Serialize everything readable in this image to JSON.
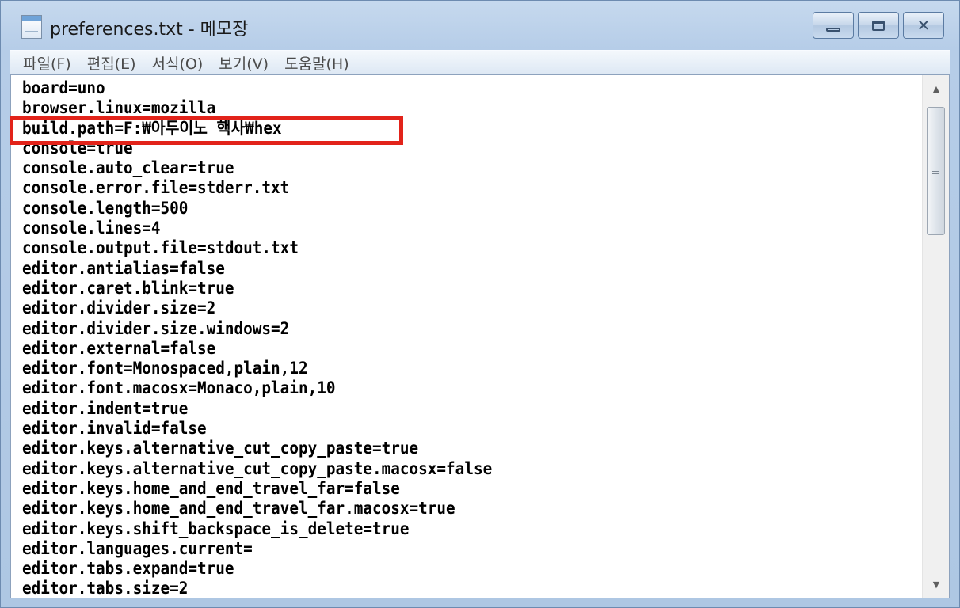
{
  "window": {
    "title": "preferences.txt - 메모장",
    "buttons": {
      "minimize": "▭",
      "maximize": "▣",
      "close": "✕"
    }
  },
  "menu": [
    "파일(F)",
    "편집(E)",
    "서식(O)",
    "보기(V)",
    "도움말(H)"
  ],
  "editor": {
    "lines": [
      "board=uno",
      "browser.linux=mozilla",
      "build.path=F:₩아두이노 핵사₩hex",
      "console=true",
      "console.auto_clear=true",
      "console.error.file=stderr.txt",
      "console.length=500",
      "console.lines=4",
      "console.output.file=stdout.txt",
      "editor.antialias=false",
      "editor.caret.blink=true",
      "editor.divider.size=2",
      "editor.divider.size.windows=2",
      "editor.external=false",
      "editor.font=Monospaced,plain,12",
      "editor.font.macosx=Monaco,plain,10",
      "editor.indent=true",
      "editor.invalid=false",
      "editor.keys.alternative_cut_copy_paste=true",
      "editor.keys.alternative_cut_copy_paste.macosx=false",
      "editor.keys.home_and_end_travel_far=false",
      "editor.keys.home_and_end_travel_far.macosx=true",
      "editor.keys.shift_backspace_is_delete=true",
      "editor.languages.current=",
      "editor.tabs.expand=true",
      "editor.tabs.size=2"
    ],
    "highlighted_line_index": 2
  },
  "colors": {
    "highlight_border": "#e2231a",
    "titlebar": "#b6cde8",
    "editor_background": "#ffffff"
  },
  "icons": {
    "app": "notepad-icon",
    "scroll_up": "triangle-up-icon",
    "scroll_down": "triangle-down-icon"
  },
  "scroll": {
    "up": "▲",
    "down": "▼"
  }
}
